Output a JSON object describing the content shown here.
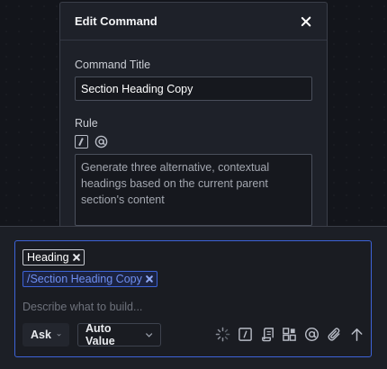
{
  "modal": {
    "title": "Edit Command",
    "command_title_label": "Command Title",
    "command_title_value": "Section Heading Copy",
    "rule_label": "Rule",
    "rule_text": "Generate three alternative, contextual headings based on the current parent section's content"
  },
  "composer": {
    "chips": [
      {
        "label": "Heading"
      },
      {
        "label": "/Section Heading Copy"
      }
    ],
    "placeholder": "Describe what to build...",
    "mode_select": {
      "value": "Ask"
    },
    "value_select": {
      "value": "Auto Value"
    },
    "icons": [
      "spinner-icon",
      "slash-command-icon",
      "scroll-icon",
      "blocks-icon",
      "at-mention-icon",
      "attach-icon",
      "send-arrow-icon"
    ]
  },
  "colors": {
    "accent": "#3d63d8",
    "chip_text": "#6f8ff0",
    "background": "#13151b",
    "panel": "#1e2129"
  }
}
